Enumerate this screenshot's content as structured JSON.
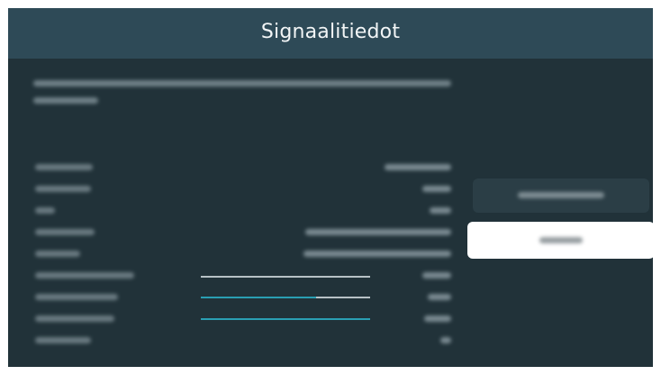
{
  "dialog": {
    "title": "Signaalitiedot"
  },
  "signal_bars": [
    {
      "fill_fraction": 0.0
    },
    {
      "fill_fraction": 0.68
    },
    {
      "fill_fraction": 1.0
    }
  ],
  "colors": {
    "page_background": "#ffffff",
    "dialog_background": "#213239",
    "title_bar_background": "#2e4a57",
    "title_text": "#f2f5f6",
    "bar_track": "#b7c1c5",
    "bar_fill": "#2a9fb3",
    "secondary_button_background": "#2b3e46",
    "primary_button_background": "#ffffff"
  }
}
